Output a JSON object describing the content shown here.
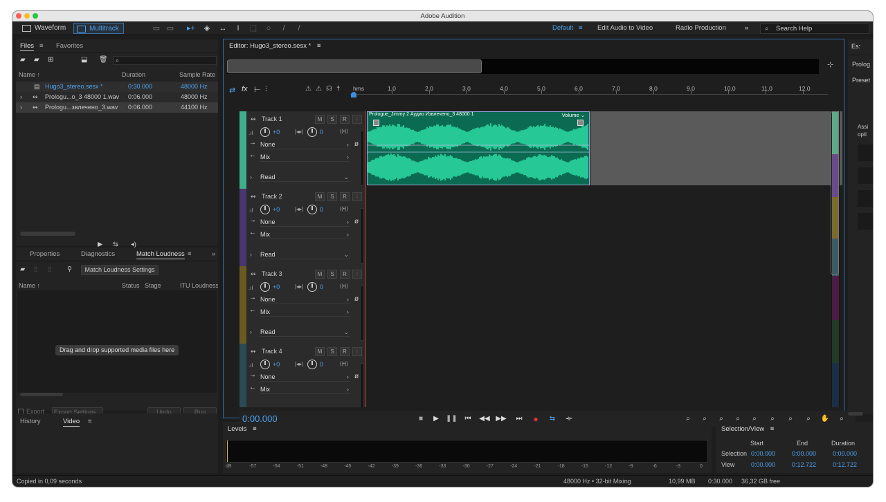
{
  "app": {
    "title": "Adobe Audition"
  },
  "toolbar": {
    "waveform_label": "Waveform",
    "multitrack_label": "Multitrack",
    "workspaces": [
      "Default",
      "Edit Audio to Video",
      "Radio Production"
    ],
    "more_label": "»",
    "search_label": "Search Help"
  },
  "files_panel": {
    "tabs": [
      "Files",
      "Favorites"
    ],
    "columns": {
      "name": "Name ↑",
      "duration": "Duration",
      "sample_rate": "Sample Rate"
    },
    "rows": [
      {
        "name": "Hugo3_stereo.sesx *",
        "duration": "0:30.000",
        "rate": "48000 Hz",
        "highlight": true
      },
      {
        "name": "Prologu...o_3 48000 1.wav",
        "duration": "0:06.000",
        "rate": "48000 Hz"
      },
      {
        "name": "Prologu...звлечено_3.wav",
        "duration": "0:06.000",
        "rate": "44100 Hz"
      }
    ]
  },
  "loudness_panel": {
    "tabs": [
      "Properties",
      "Diagnostics",
      "Match Loudness"
    ],
    "settings_button": "Match Loudness Settings",
    "columns": {
      "name": "Name ↑",
      "status": "Status",
      "stage": "Stage",
      "itu": "ITU Loudness"
    },
    "drop_hint": "Drag and drop supported media files here",
    "export_label": "Export",
    "export_settings": "Export Settings...",
    "undo": "Undo",
    "run": "Run"
  },
  "history_panel": {
    "tabs": [
      "History",
      "Video"
    ]
  },
  "editor": {
    "title": "Editor: Hugo3_stereo.sesx *",
    "ruler_unit": "hms",
    "ruler_ticks": [
      "1,0",
      "2,0",
      "3,0",
      "4,0",
      "5,0",
      "6,0",
      "7,0",
      "8,0",
      "9,0",
      "10,0",
      "11,0",
      "12,0"
    ],
    "tracks": [
      {
        "name": "Track 1",
        "color": "#3fae8a",
        "volume": "+0",
        "pan": "0",
        "input": "None",
        "output": "Mix",
        "mode": "Read"
      },
      {
        "name": "Track 2",
        "color": "#4a3570",
        "volume": "+0",
        "pan": "0",
        "input": "None",
        "output": "Mix",
        "mode": "Read"
      },
      {
        "name": "Track 3",
        "color": "#6a5a20",
        "volume": "+0",
        "pan": "0",
        "input": "None",
        "output": "Mix",
        "mode": "Read"
      },
      {
        "name": "Track 4",
        "color": "#2a4a55",
        "volume": "+0",
        "pan": "0",
        "input": "None",
        "output": "Mix",
        "mode": ""
      }
    ],
    "msr": [
      "M",
      "S",
      "R"
    ],
    "clip": {
      "title": "Prologue_Jimmy 2 Аудио Извлечено_3 48000 1",
      "volume_label": "Volume"
    },
    "time": "0:00.000"
  },
  "essential_panel": {
    "tab": "Es:",
    "items": [
      "Prolog",
      "Preset"
    ],
    "assign": "Assi opti"
  },
  "levels": {
    "title": "Levels",
    "scale": [
      "dB",
      "-57",
      "-54",
      "-51",
      "-48",
      "-45",
      "-42",
      "-39",
      "-36",
      "-33",
      "-30",
      "-27",
      "-24",
      "-21",
      "-18",
      "-15",
      "-12",
      "-9",
      "-6",
      "-3",
      "0"
    ]
  },
  "selection_view": {
    "title": "Selection/View",
    "headers": [
      "Start",
      "End",
      "Duration"
    ],
    "rows": [
      {
        "label": "Selection",
        "start": "0:00.000",
        "end": "0:00.000",
        "duration": "0:00.000"
      },
      {
        "label": "View",
        "start": "0:00.000",
        "end": "0:12.722",
        "duration": "0:12.722"
      }
    ]
  },
  "status_bar": {
    "left": "Copied in 0,09 seconds",
    "mixing": "48000 Hz • 32-bit Mixing",
    "memory": "10,99 MB",
    "duration": "0:30.000",
    "free": "36,32 GB free"
  }
}
